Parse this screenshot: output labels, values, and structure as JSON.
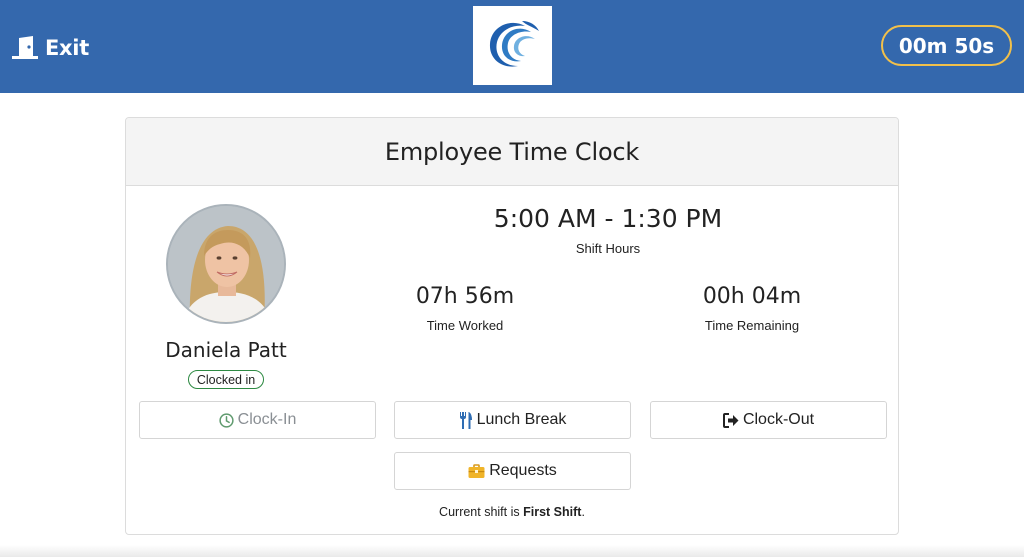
{
  "header": {
    "exit_label": "Exit",
    "timer": "00m 50s",
    "bar_color": "#3468ad",
    "timer_border_color": "#f2c04a"
  },
  "card": {
    "title": "Employee Time Clock"
  },
  "employee": {
    "name": "Daniela Patt",
    "status": "Clocked in",
    "status_color": "#2e8a43"
  },
  "shift": {
    "hours": "5:00 AM - 1:30 PM",
    "hours_label": "Shift Hours",
    "worked_value": "07h 56m",
    "worked_label": "Time Worked",
    "remaining_value": "00h 04m",
    "remaining_label": "Time Remaining"
  },
  "actions": {
    "clock_in": "Clock-In",
    "lunch_break": "Lunch Break",
    "clock_out": "Clock-Out",
    "requests": "Requests"
  },
  "footer": {
    "prefix": "Current shift is ",
    "shift_name": "First Shift",
    "suffix": "."
  },
  "icons": {
    "exit": "door-exit-icon",
    "logo": "wave-logo",
    "clock_in": "clock-icon",
    "lunch": "utensils-icon",
    "clock_out": "sign-out-icon",
    "requests": "briefcase-icon"
  }
}
